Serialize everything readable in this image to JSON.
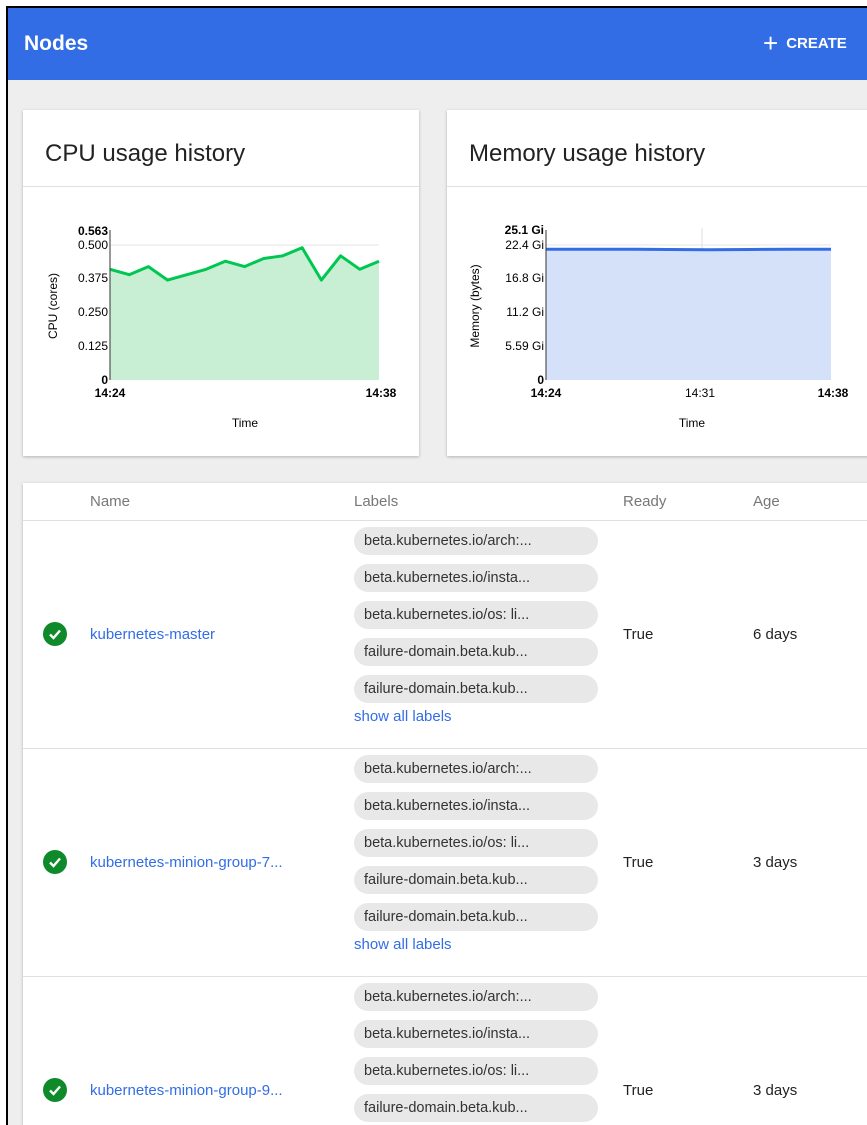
{
  "header": {
    "title": "Nodes",
    "create_label": "CREATE"
  },
  "cpu_chart": {
    "title": "CPU usage history",
    "chart_data": {
      "type": "area",
      "title": "CPU usage history",
      "xlabel": "Time",
      "ylabel": "CPU (cores)",
      "x_ticks": [
        "14:24",
        "14:38"
      ],
      "y_ticks": [
        "0",
        "0.125",
        "0.250",
        "0.375",
        "0.500",
        "0.563"
      ],
      "ylim": [
        0,
        0.563
      ],
      "color": "#00c752",
      "fill": "#c8efd4",
      "values": [
        0.41,
        0.39,
        0.42,
        0.37,
        0.39,
        0.41,
        0.44,
        0.42,
        0.45,
        0.46,
        0.49,
        0.37,
        0.46,
        0.41,
        0.44
      ]
    }
  },
  "memory_chart": {
    "title": "Memory usage history",
    "chart_data": {
      "type": "area",
      "title": "Memory usage history",
      "xlabel": "Time",
      "ylabel": "Memory (bytes)",
      "x_ticks": [
        "14:24",
        "14:31",
        "14:38"
      ],
      "y_ticks": [
        "0",
        "5.59 Gi",
        "11.2 Gi",
        "16.8 Gi",
        "22.4 Gi",
        "25.1 Gi"
      ],
      "ylim": [
        0,
        25.1
      ],
      "color": "#326de6",
      "fill": "#d4e1f8",
      "values": [
        21.6,
        21.6,
        21.6,
        21.55,
        21.5,
        21.55,
        21.6,
        21.6
      ]
    }
  },
  "table": {
    "columns": {
      "name": "Name",
      "labels": "Labels",
      "ready": "Ready",
      "age": "Age"
    },
    "show_all_label": "show all labels",
    "rows": [
      {
        "name": "kubernetes-master",
        "ready": "True",
        "age": "6 days",
        "labels": [
          "beta.kubernetes.io/arch:...",
          "beta.kubernetes.io/insta...",
          "beta.kubernetes.io/os: li...",
          "failure-domain.beta.kub...",
          "failure-domain.beta.kub..."
        ]
      },
      {
        "name": "kubernetes-minion-group-7...",
        "ready": "True",
        "age": "3 days",
        "labels": [
          "beta.kubernetes.io/arch:...",
          "beta.kubernetes.io/insta...",
          "beta.kubernetes.io/os: li...",
          "failure-domain.beta.kub...",
          "failure-domain.beta.kub..."
        ]
      },
      {
        "name": "kubernetes-minion-group-9...",
        "ready": "True",
        "age": "3 days",
        "labels": [
          "beta.kubernetes.io/arch:...",
          "beta.kubernetes.io/insta...",
          "beta.kubernetes.io/os: li...",
          "failure-domain.beta.kub..."
        ]
      }
    ]
  }
}
